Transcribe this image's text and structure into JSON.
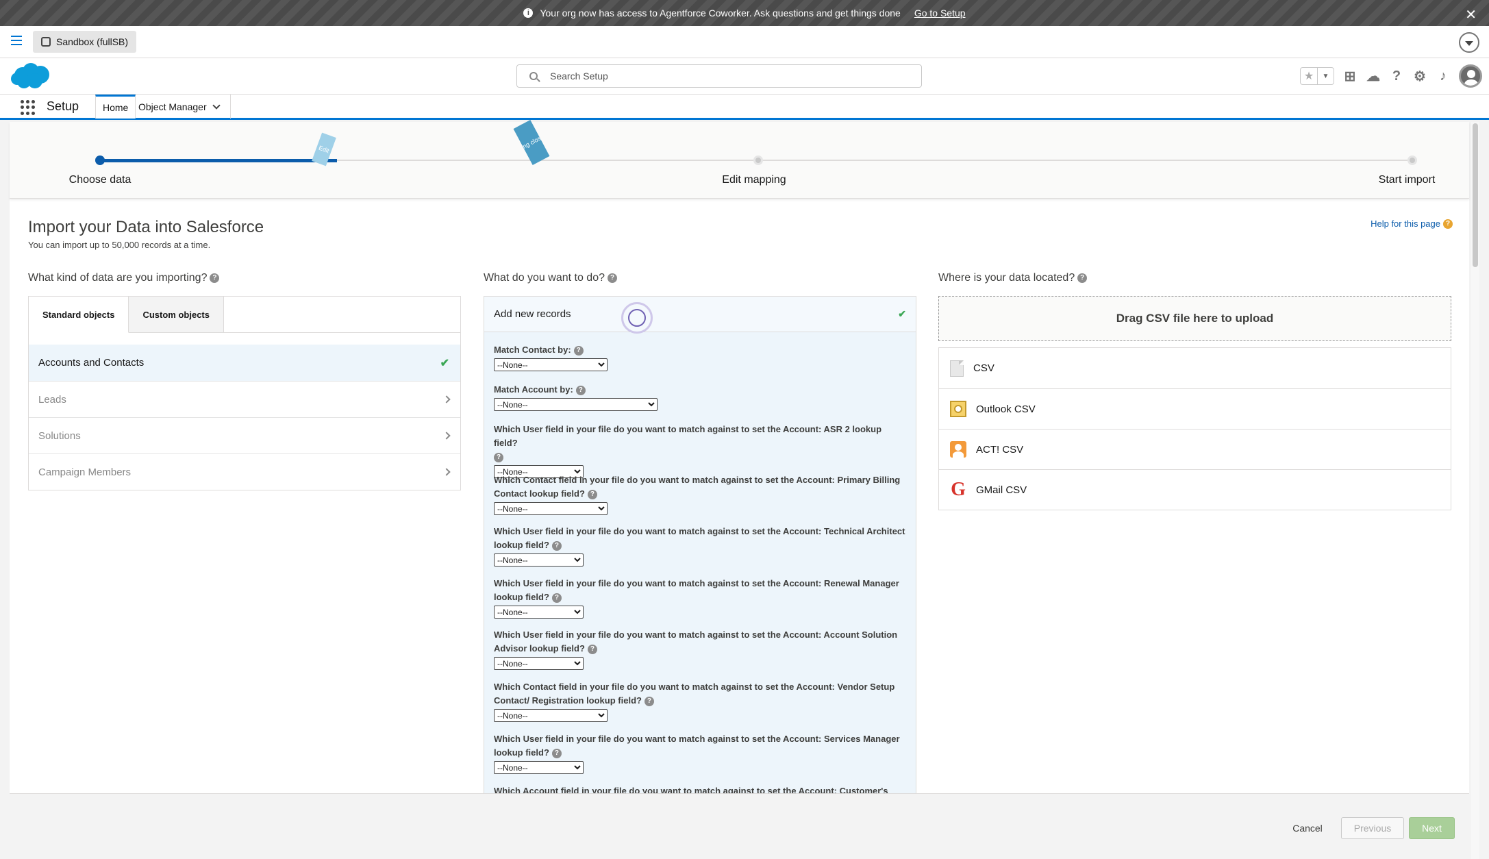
{
  "banner": {
    "message": "Your org now has access to Agentforce Coworker. Ask questions and get things done",
    "link": "Go to Setup",
    "close": "✕"
  },
  "sandbox": {
    "label": "Sandbox (fullSB)"
  },
  "search": {
    "placeholder": "Search Setup"
  },
  "nav": {
    "app_name": "Setup",
    "tabs": [
      "Home",
      "Object Manager"
    ]
  },
  "progress": {
    "steps": [
      "Choose data",
      "Edit mapping",
      "Start import"
    ],
    "current_step": 1,
    "ribbons": [
      "Edit",
      "Ring closer"
    ]
  },
  "page": {
    "title": "Import your Data into Salesforce",
    "subtitle": "You can import up to 50,000 records at a time.",
    "help": "Help for this page"
  },
  "col1": {
    "heading": "What kind of data are you importing?",
    "tabs": [
      "Standard objects",
      "Custom objects"
    ],
    "items": [
      "Accounts and Contacts",
      "Leads",
      "Solutions",
      "Campaign Members"
    ]
  },
  "col2": {
    "heading": "What do you want to do?",
    "action": "Add new records",
    "none_option": "--None--",
    "fields": [
      "Match Contact by:",
      "Match Account by:",
      "Which User field in your file do you want to match against to set the Account: ASR 2 lookup field?",
      "Which Contact field in your file do you want to match against to set the Account: Primary Billing Contact lookup field?",
      "Which User field in your file do you want to match against to set the Account: Technical Architect lookup field?",
      "Which User field in your file do you want to match against to set the Account: Renewal Manager lookup field?",
      "Which User field in your file do you want to match against to set the Account: Account Solution Advisor lookup field?",
      "Which Contact field in your file do you want to match against to set the Account: Vendor Setup Contact/ Registration lookup field?",
      "Which User field in your file do you want to match against to set the Account: Services Manager lookup field?",
      "Which Account field in your file do you want to match against to set the Account: Customer's"
    ]
  },
  "col3": {
    "heading": "Where is your data located?",
    "drop": "Drag CSV file here to upload",
    "sources": [
      "CSV",
      "Outlook CSV",
      "ACT! CSV",
      "GMail CSV"
    ]
  },
  "footer": {
    "cancel": "Cancel",
    "previous": "Previous",
    "next": "Next"
  },
  "colors": {
    "brand": "#0176d3",
    "progress": "#0b5cab",
    "success": "#3ba755",
    "next_disabled": "#a9cf99"
  }
}
